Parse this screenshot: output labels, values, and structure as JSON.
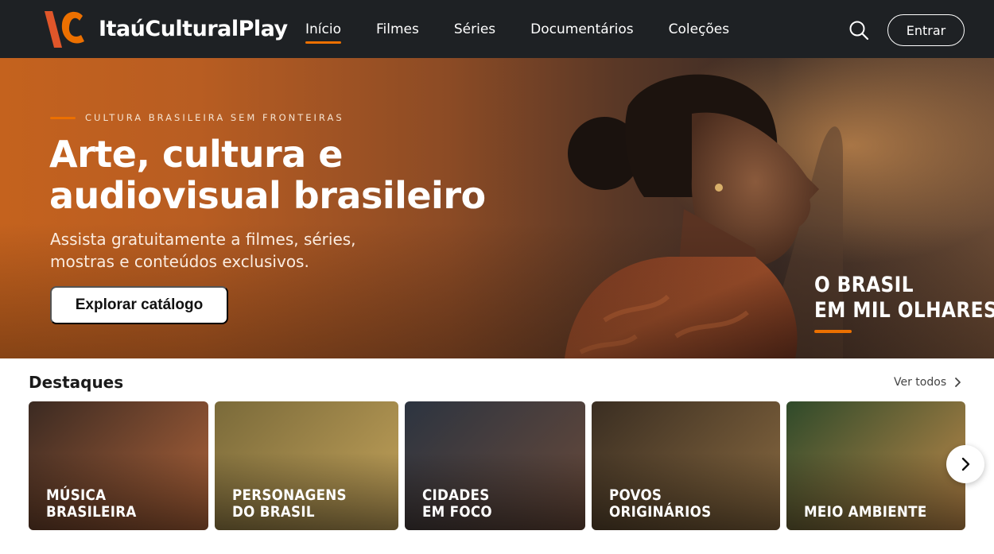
{
  "brand": {
    "name": "ItaúCulturalPlay",
    "accent": "#ec7000"
  },
  "nav": {
    "items": [
      {
        "label": "Início",
        "active": true
      },
      {
        "label": "Filmes",
        "active": false
      },
      {
        "label": "Séries",
        "active": false
      },
      {
        "label": "Documentários",
        "active": false
      },
      {
        "label": "Coleções",
        "active": false
      }
    ],
    "search_icon": "search-icon",
    "login_label": "Entrar"
  },
  "hero": {
    "eyebrow": "CULTURA BRASILEIRA SEM FRONTEIRAS",
    "title_line1": "Arte, cultura e",
    "title_line2": "audiovisual brasileiro",
    "subtitle_line1": "Assista gratuitamente a filmes, séries,",
    "subtitle_line2": "mostras e conteúdos exclusivos.",
    "cta_label": "Explorar catálogo",
    "tagline_line1": "O BRASIL",
    "tagline_line2": "EM MIL OLHARES"
  },
  "highlights": {
    "title": "Destaques",
    "see_all": "Ver todos",
    "cards": [
      {
        "label": "MÚSICA\nBRASILEIRA",
        "colors": [
          "#3b2a22",
          "#b0643a"
        ]
      },
      {
        "label": "PERSONAGENS\nDO BRASIL",
        "colors": [
          "#7a6a3a",
          "#c4a35a"
        ]
      },
      {
        "label": "CIDADES\nEM FOCO",
        "colors": [
          "#2c3440",
          "#6a4a3a"
        ]
      },
      {
        "label": "POVOS\nORIGINÁRIOS",
        "colors": [
          "#3a2e22",
          "#8a6a40"
        ]
      },
      {
        "label": "MEIO AMBIENTE",
        "colors": [
          "#2f4a2a",
          "#c08a4a"
        ]
      }
    ]
  }
}
